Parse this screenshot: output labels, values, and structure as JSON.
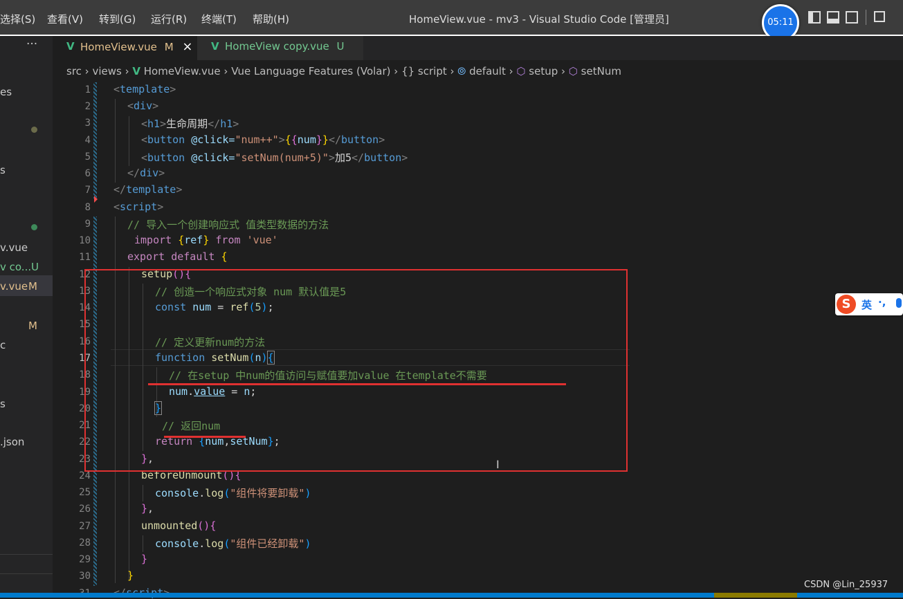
{
  "menu": [
    "选择(S)",
    "查看(V)",
    "转到(G)",
    "运行(R)",
    "终端(T)",
    "帮助(H)"
  ],
  "window_title": "HomeView.vue - mv3 - Visual Studio Code [管理员]",
  "timer": "05:11",
  "sidebar": {
    "more": "···",
    "items": [
      "es",
      "s",
      "v.vue",
      "v co...",
      "v.vue",
      "c",
      "s",
      ".json"
    ],
    "badges": [
      "U",
      "M",
      "M"
    ]
  },
  "tabs": [
    {
      "label": "HomeView.vue",
      "badge": "M",
      "close": "×"
    },
    {
      "label": "HomeView copy.vue",
      "badge": "U"
    }
  ],
  "breadcrumb": [
    "src",
    "views",
    "HomeView.vue",
    "Vue Language Features (Volar)",
    "{} script",
    "default",
    "setup",
    "setNum"
  ],
  "ime": {
    "mode": "英",
    "extra": "·,"
  },
  "watermark": "CSDN @Lin_25937",
  "line_numbers": [
    "1",
    "2",
    "3",
    "4",
    "5",
    "6",
    "7",
    "8",
    "9",
    "10",
    "11",
    "12",
    "13",
    "14",
    "15",
    "16",
    "17",
    "18",
    "19",
    "20",
    "21",
    "22",
    "23",
    "24",
    "25",
    "26",
    "27",
    "28",
    "29",
    "30",
    "31"
  ],
  "code": {
    "l3_text": "生命周期",
    "l4_event": "@click=",
    "l4_val": "\"num++\"",
    "l5_val": "\"setNum(num+5)\"",
    "l5_text": "加5",
    "l9": "// 导入一个创建响应式 值类型数据的方法",
    "l10_str": "'vue'",
    "l13": "// 创造一个响应式对象 num 默认值是5",
    "l16": "// 定义更新num的方法",
    "l18": "// 在setup 中num的值访问与赋值要加value 在template不需要",
    "l21": "// 返回num",
    "l25_str": "\"组件将要卸载\"",
    "l28_str": "\"组件已经卸载\""
  }
}
